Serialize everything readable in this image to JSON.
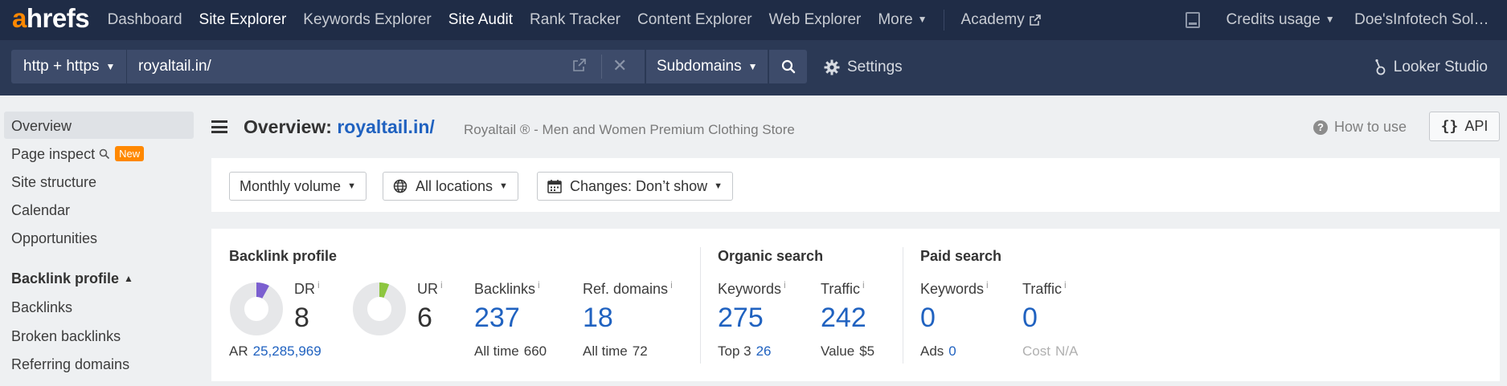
{
  "topnav": {
    "logo_a": "a",
    "logo_rest": "hrefs",
    "items": [
      {
        "label": "Dashboard"
      },
      {
        "label": "Site Explorer"
      },
      {
        "label": "Keywords Explorer"
      },
      {
        "label": "Site Audit"
      },
      {
        "label": "Rank Tracker"
      },
      {
        "label": "Content Explorer"
      },
      {
        "label": "Web Explorer"
      },
      {
        "label": "More"
      }
    ],
    "academy": "Academy",
    "credits": "Credits usage",
    "account": "Doe'sInfotech Sol…"
  },
  "searchbar": {
    "protocol": "http + https",
    "url": "royaltail.in/",
    "mode": "Subdomains",
    "settings": "Settings",
    "looker": "Looker Studio"
  },
  "sidebar": {
    "items": [
      {
        "label": "Overview"
      },
      {
        "label": "Page inspect"
      },
      {
        "label": "Site structure"
      },
      {
        "label": "Calendar"
      },
      {
        "label": "Opportunities"
      }
    ],
    "new_badge": "New",
    "section": "Backlink profile",
    "section_items": [
      {
        "label": "Backlinks"
      },
      {
        "label": "Broken backlinks"
      },
      {
        "label": "Referring domains"
      }
    ]
  },
  "header": {
    "title_prefix": "Overview:",
    "title_link": "royaltail.in/",
    "subtitle": "Royaltail ® - Men and Women Premium Clothing Store",
    "howto": "How to use",
    "api": "API"
  },
  "filters": {
    "volume": "Monthly volume",
    "locations": "All locations",
    "changes": "Changes: Don’t show"
  },
  "metrics": {
    "info_marker": "i",
    "backlink_profile": {
      "title": "Backlink profile",
      "dr": {
        "label": "DR",
        "value": "8",
        "fraction": 0.08,
        "color": "#7b5fd0"
      },
      "ur": {
        "label": "UR",
        "value": "6",
        "fraction": 0.06,
        "color": "#8dc63f"
      },
      "ar_label": "AR",
      "ar_value": "25,285,969",
      "backlinks": {
        "label": "Backlinks",
        "value": "237",
        "sub_label": "All time",
        "sub_value": "660"
      },
      "ref_domains": {
        "label": "Ref. domains",
        "value": "18",
        "sub_label": "All time",
        "sub_value": "72"
      }
    },
    "organic": {
      "title": "Organic search",
      "keywords": {
        "label": "Keywords",
        "value": "275",
        "sub_label": "Top 3",
        "sub_value": "26"
      },
      "traffic": {
        "label": "Traffic",
        "value": "242",
        "sub_label": "Value",
        "sub_value": "$5"
      }
    },
    "paid": {
      "title": "Paid search",
      "keywords": {
        "label": "Keywords",
        "value": "0",
        "sub_label": "Ads",
        "sub_value": "0"
      },
      "traffic": {
        "label": "Traffic",
        "value": "0",
        "sub_label": "Cost",
        "sub_value": "N/A"
      }
    }
  }
}
